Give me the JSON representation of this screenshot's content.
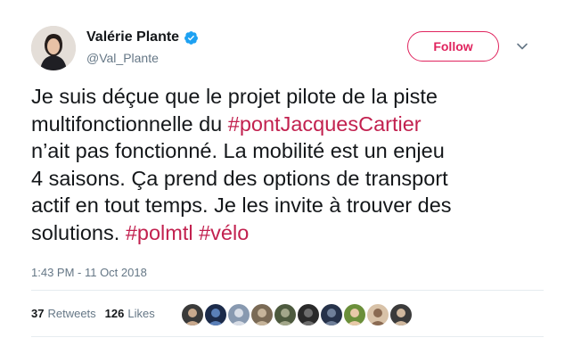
{
  "author": {
    "name": "Valérie Plante",
    "handle": "@Val_Plante",
    "verified_icon": "verified-badge-icon"
  },
  "actions": {
    "follow_label": "Follow",
    "menu_icon": "chevron-down-icon"
  },
  "tweet": {
    "lines": [
      [
        {
          "t": "Je suis déçue que le projet pilote de la piste",
          "tag": false
        }
      ],
      [
        {
          "t": "multifonctionnelle du ",
          "tag": false
        },
        {
          "t": "#pontJacquesCartier",
          "tag": true
        }
      ],
      [
        {
          "t": "n’ait pas fonctionné. La mobilité est un enjeu",
          "tag": false
        }
      ],
      [
        {
          "t": "4 saisons. Ça prend des options de transport",
          "tag": false
        }
      ],
      [
        {
          "t": "actif en tout temps. Je les invite à trouver des",
          "tag": false
        }
      ],
      [
        {
          "t": "solutions. ",
          "tag": false
        },
        {
          "t": "#polmtl",
          "tag": true
        },
        {
          "t": " ",
          "tag": false
        },
        {
          "t": "#vélo",
          "tag": true
        }
      ]
    ],
    "timestamp": "1:43 PM - 11 Oct 2018"
  },
  "stats": {
    "retweets_count": "37",
    "retweets_label": "Retweets",
    "likes_count": "126",
    "likes_label": "Likes"
  },
  "colors": {
    "accent": "#e0245e",
    "hashtag": "#c2214f",
    "verified": "#1da1f2"
  },
  "likers": [
    {
      "bg": "#3a3a3a",
      "fg": "#c9a98d"
    },
    {
      "bg": "#1c2b4a",
      "fg": "#5a7fb8"
    },
    {
      "bg": "#8899b0",
      "fg": "#d8dde6"
    },
    {
      "bg": "#7a6a55",
      "fg": "#c6b49a"
    },
    {
      "bg": "#4d5a3e",
      "fg": "#a3a78a"
    },
    {
      "bg": "#2a2a2a",
      "fg": "#6d6d6d"
    },
    {
      "bg": "#26324a",
      "fg": "#6f7f99"
    },
    {
      "bg": "#6b8f3a",
      "fg": "#e8c9a8"
    },
    {
      "bg": "#d8c2a8",
      "fg": "#8a6a52"
    },
    {
      "bg": "#3b3b3b",
      "fg": "#d0b89e"
    }
  ]
}
